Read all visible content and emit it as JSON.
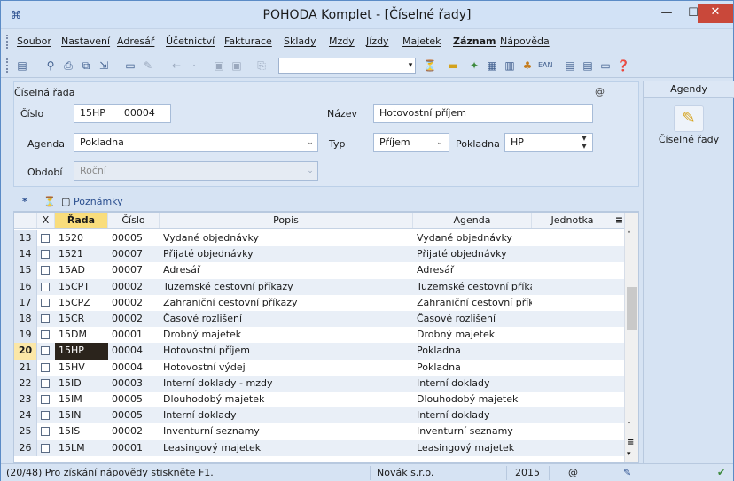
{
  "window": {
    "title": "POHODA Komplet - [Číselné řady]",
    "icons": {
      "app": "pohoda-icon",
      "min": "minimize-icon",
      "max": "maximize-icon",
      "close": "close-icon"
    }
  },
  "menu": [
    {
      "label": "Soubor"
    },
    {
      "label": "Nastavení"
    },
    {
      "label": "Adresář"
    },
    {
      "label": "Účetnictví"
    },
    {
      "label": "Fakturace"
    },
    {
      "label": "Sklady"
    },
    {
      "label": "Mzdy"
    },
    {
      "label": "Jízdy"
    },
    {
      "label": "Majetek"
    },
    {
      "label": "Záznam",
      "bold": true
    },
    {
      "label": "Nápověda"
    }
  ],
  "toolbar": {
    "icons": [
      "agenda-icon",
      "search-icon",
      "print-icon",
      "print-preview-icon",
      "export-icon",
      "new-record-icon",
      "edit-icon",
      "back-icon",
      "forward-icon",
      "save-icon",
      "save-all-icon",
      "copy-icon",
      "filter-icon",
      "folder-icon",
      "tools-icon",
      "calculator-icon",
      "table-icon",
      "contacts-icon",
      "ean-icon",
      "list-icon",
      "list2-icon",
      "form-icon",
      "help-icon"
    ],
    "combo_value": ""
  },
  "form": {
    "section_title": "Číselná řada",
    "cislo_label": "Číslo",
    "cislo_code": "15HP",
    "cislo_number": "00004",
    "nazev_label": "Název",
    "nazev_value": "Hotovostní příjem",
    "agenda_label": "Agenda",
    "agenda_value": "Pokladna",
    "typ_label": "Typ",
    "typ_value": "Příjem",
    "pokladna_label": "Pokladna",
    "pokladna_value": "HP",
    "obdobi_label": "Období",
    "obdobi_value": "Roční",
    "at_symbol": "@"
  },
  "sidebar": {
    "header": "Agendy",
    "item_label": "Číselné řady"
  },
  "gridtabs": {
    "star": "*",
    "poznamky": "Poznámky"
  },
  "grid": {
    "headers": {
      "x": "X",
      "rada": "Řada",
      "cislo": "Číslo",
      "popis": "Popis",
      "agenda": "Agenda",
      "jednotka": "Jednotka"
    },
    "rows": [
      {
        "n": "13",
        "rada": "1520",
        "cislo": "00005",
        "popis": "Vydané objednávky",
        "agenda": "Vydané objednávky"
      },
      {
        "n": "14",
        "rada": "1521",
        "cislo": "00007",
        "popis": "Přijaté objednávky",
        "agenda": "Přijaté objednávky"
      },
      {
        "n": "15",
        "rada": "15AD",
        "cislo": "00007",
        "popis": "Adresář",
        "agenda": "Adresář"
      },
      {
        "n": "16",
        "rada": "15CPT",
        "cislo": "00002",
        "popis": "Tuzemské cestovní příkazy",
        "agenda": "Tuzemské cestovní příkazy"
      },
      {
        "n": "17",
        "rada": "15CPZ",
        "cislo": "00002",
        "popis": "Zahraniční cestovní příkazy",
        "agenda": "Zahraniční cestovní příkaz"
      },
      {
        "n": "18",
        "rada": "15CR",
        "cislo": "00002",
        "popis": "Časové rozlišení",
        "agenda": "Časové rozlišení"
      },
      {
        "n": "19",
        "rada": "15DM",
        "cislo": "00001",
        "popis": "Drobný majetek",
        "agenda": "Drobný majetek"
      },
      {
        "n": "20",
        "rada": "15HP",
        "cislo": "00004",
        "popis": "Hotovostní příjem",
        "agenda": "Pokladna",
        "selected": true
      },
      {
        "n": "21",
        "rada": "15HV",
        "cislo": "00004",
        "popis": "Hotovostní výdej",
        "agenda": "Pokladna"
      },
      {
        "n": "22",
        "rada": "15ID",
        "cislo": "00003",
        "popis": "Interní doklady - mzdy",
        "agenda": "Interní doklady"
      },
      {
        "n": "23",
        "rada": "15IM",
        "cislo": "00005",
        "popis": "Dlouhodobý majetek",
        "agenda": "Dlouhodobý majetek"
      },
      {
        "n": "24",
        "rada": "15IN",
        "cislo": "00005",
        "popis": "Interní doklady",
        "agenda": "Interní doklady"
      },
      {
        "n": "25",
        "rada": "15IS",
        "cislo": "00002",
        "popis": "Inventurní seznamy",
        "agenda": "Inventurní seznamy"
      },
      {
        "n": "26",
        "rada": "15LM",
        "cislo": "00001",
        "popis": "Leasingový majetek",
        "agenda": "Leasingový majetek"
      }
    ]
  },
  "status": {
    "help": "(20/48) Pro získání nápovědy stiskněte F1.",
    "company": "Novák s.r.o.",
    "year": "2015",
    "at": "@"
  }
}
